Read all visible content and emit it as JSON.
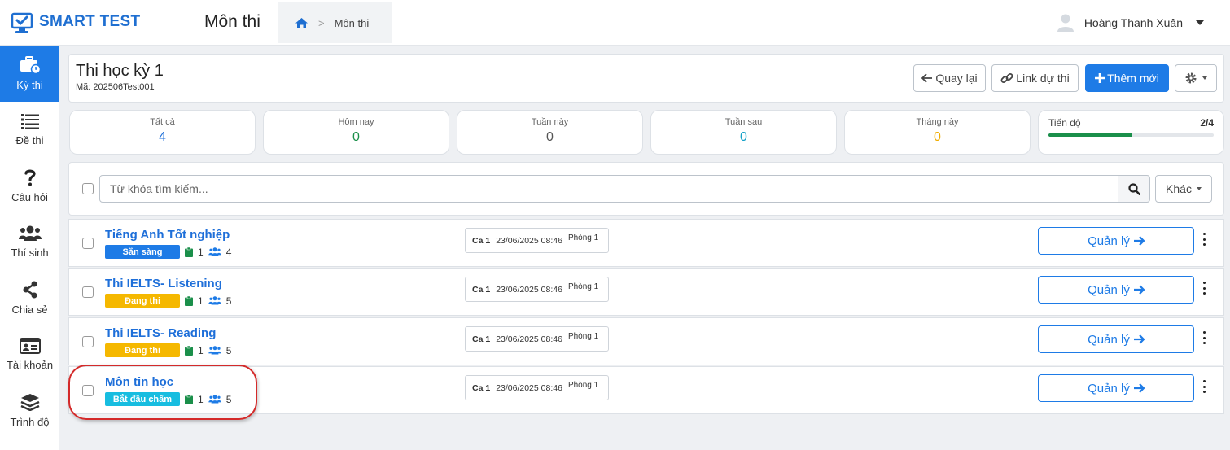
{
  "header": {
    "brand": "SMART TEST",
    "page_title": "Môn thi",
    "breadcrumb": {
      "current": "Môn thi"
    },
    "user": {
      "name": "Hoàng Thanh Xuân"
    }
  },
  "sidebar": {
    "items": [
      {
        "label": "Kỳ thi",
        "icon": "briefcase-clock-icon",
        "active": true
      },
      {
        "label": "Đề thi",
        "icon": "list-icon",
        "active": false
      },
      {
        "label": "Câu hỏi",
        "icon": "question-icon",
        "active": false
      },
      {
        "label": "Thí sinh",
        "icon": "users-icon",
        "active": false
      },
      {
        "label": "Chia sẻ",
        "icon": "share-icon",
        "active": false
      },
      {
        "label": "Tài khoản",
        "icon": "id-card-icon",
        "active": false
      },
      {
        "label": "Trình độ",
        "icon": "layers-icon",
        "active": false
      }
    ]
  },
  "exam": {
    "title": "Thi học kỳ 1",
    "code": "Mã: 202506Test001"
  },
  "toolbar": {
    "back_label": "Quay lại",
    "link_label": "Link dự thi",
    "add_label": "Thêm mới"
  },
  "stats": [
    {
      "label": "Tất cả",
      "value": "4",
      "color": "#1e6fd9"
    },
    {
      "label": "Hôm nay",
      "value": "0",
      "color": "#1a8f4a"
    },
    {
      "label": "Tuần này",
      "value": "0",
      "color": "#555555"
    },
    {
      "label": "Tuần sau",
      "value": "0",
      "color": "#17a2c8"
    },
    {
      "label": "Tháng này",
      "value": "0",
      "color": "#f0ad00"
    }
  ],
  "progress": {
    "label": "Tiến độ",
    "value": "2/4",
    "fraction": 0.5,
    "color": "#1a8f4a"
  },
  "search": {
    "placeholder": "Từ khóa tìm kiếm...",
    "other_label": "Khác"
  },
  "subjects": [
    {
      "name": "Tiếng Anh Tốt nghiệp",
      "status": "Sẵn sàng",
      "status_color": "#1e7be6",
      "papers": "1",
      "students": "4",
      "session": "Ca 1",
      "datetime": "23/06/2025 08:46",
      "room": "Phòng 1",
      "manage_label": "Quản lý"
    },
    {
      "name": "Thi IELTS- Listening",
      "status": "Đang thi",
      "status_color": "#f5b800",
      "papers": "1",
      "students": "5",
      "session": "Ca 1",
      "datetime": "23/06/2025 08:46",
      "room": "Phòng 1",
      "manage_label": "Quản lý"
    },
    {
      "name": "Thi IELTS- Reading",
      "status": "Đang thi",
      "status_color": "#f5b800",
      "papers": "1",
      "students": "5",
      "session": "Ca 1",
      "datetime": "23/06/2025 08:46",
      "room": "Phòng 1",
      "manage_label": "Quản lý"
    },
    {
      "name": "Môn tin học",
      "status": "Bắt đầu chấm",
      "status_color": "#17bde0",
      "papers": "1",
      "students": "5",
      "session": "Ca 1",
      "datetime": "23/06/2025 08:46",
      "room": "Phòng 1",
      "manage_label": "Quản lý"
    }
  ]
}
